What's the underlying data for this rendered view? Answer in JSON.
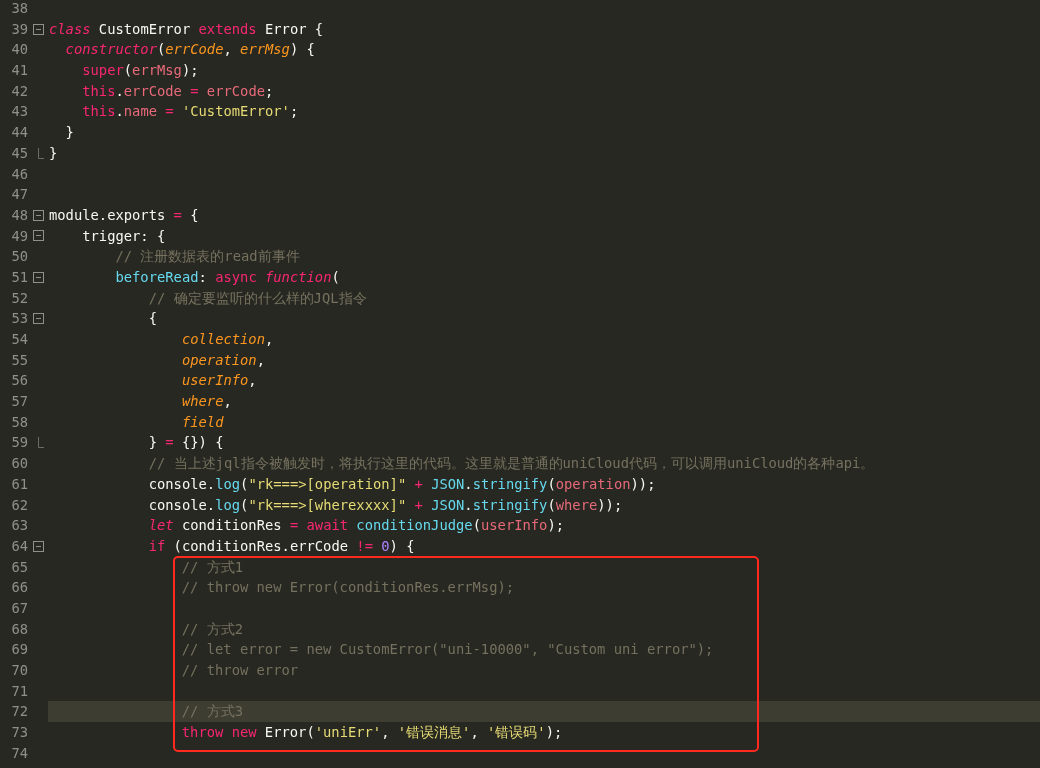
{
  "editor": {
    "lines": [
      {
        "number": "38"
      },
      {
        "number": "39",
        "collapsible": true,
        "tokens": [
          {
            "kind": "storage",
            "text": "class"
          },
          {
            "kind": "plain",
            "text": " CustomError "
          },
          {
            "kind": "keyword",
            "text": "extends"
          },
          {
            "kind": "plain",
            "text": " Error {"
          }
        ]
      },
      {
        "number": "40",
        "tokens": [
          {
            "kind": "storage",
            "text": "  constructor"
          },
          {
            "kind": "plain",
            "text": "("
          },
          {
            "kind": "param",
            "text": "errCode"
          },
          {
            "kind": "plain",
            "text": ", "
          },
          {
            "kind": "param",
            "text": "errMsg"
          },
          {
            "kind": "plain",
            "text": ") {"
          }
        ]
      },
      {
        "number": "41",
        "tokens": [
          {
            "kind": "keyword",
            "text": "    super"
          },
          {
            "kind": "plain",
            "text": "("
          },
          {
            "kind": "variable",
            "text": "errMsg"
          },
          {
            "kind": "plain",
            "text": ");"
          }
        ]
      },
      {
        "number": "42",
        "tokens": [
          {
            "kind": "keyword",
            "text": "    this"
          },
          {
            "kind": "plain",
            "text": "."
          },
          {
            "kind": "variable",
            "text": "errCode"
          },
          {
            "kind": "keyword",
            "text": " = "
          },
          {
            "kind": "variable",
            "text": "errCode"
          },
          {
            "kind": "plain",
            "text": ";"
          }
        ]
      },
      {
        "number": "43",
        "tokens": [
          {
            "kind": "keyword",
            "text": "    this"
          },
          {
            "kind": "plain",
            "text": "."
          },
          {
            "kind": "variable",
            "text": "name"
          },
          {
            "kind": "keyword",
            "text": " = "
          },
          {
            "kind": "string",
            "text": "'CustomError'"
          },
          {
            "kind": "plain",
            "text": ";"
          }
        ]
      },
      {
        "number": "44",
        "tokens": [
          {
            "kind": "plain",
            "text": "  }"
          }
        ]
      },
      {
        "number": "45",
        "fold_end": true,
        "tokens": [
          {
            "kind": "plain",
            "text": "}"
          }
        ]
      },
      {
        "number": "46"
      },
      {
        "number": "47"
      },
      {
        "number": "48",
        "collapsible": true,
        "tokens": [
          {
            "kind": "plain",
            "text": "module.exports"
          },
          {
            "kind": "keyword",
            "text": " = "
          },
          {
            "kind": "plain",
            "text": "{"
          }
        ]
      },
      {
        "number": "49",
        "collapsible": true,
        "tokens": [
          {
            "kind": "plain",
            "text": "    trigger: {"
          }
        ]
      },
      {
        "number": "50",
        "tokens": [
          {
            "kind": "comment",
            "text": "        // 注册数据表的read前事件"
          }
        ]
      },
      {
        "number": "51",
        "collapsible": true,
        "tokens": [
          {
            "kind": "support",
            "text": "        beforeRead"
          },
          {
            "kind": "plain",
            "text": ": "
          },
          {
            "kind": "keyword",
            "text": "async "
          },
          {
            "kind": "storage",
            "text": "function"
          },
          {
            "kind": "plain",
            "text": "("
          }
        ]
      },
      {
        "number": "52",
        "tokens": [
          {
            "kind": "comment",
            "text": "            // 确定要监听的什么样的JQL指令"
          }
        ]
      },
      {
        "number": "53",
        "collapsible": true,
        "tokens": [
          {
            "kind": "plain",
            "text": "            {"
          }
        ]
      },
      {
        "number": "54",
        "tokens": [
          {
            "kind": "param",
            "text": "                collection"
          },
          {
            "kind": "plain",
            "text": ","
          }
        ]
      },
      {
        "number": "55",
        "tokens": [
          {
            "kind": "param",
            "text": "                operation"
          },
          {
            "kind": "plain",
            "text": ","
          }
        ]
      },
      {
        "number": "56",
        "tokens": [
          {
            "kind": "param",
            "text": "                userInfo"
          },
          {
            "kind": "plain",
            "text": ","
          }
        ]
      },
      {
        "number": "57",
        "tokens": [
          {
            "kind": "param",
            "text": "                where"
          },
          {
            "kind": "plain",
            "text": ","
          }
        ]
      },
      {
        "number": "58",
        "tokens": [
          {
            "kind": "param",
            "text": "                field"
          }
        ]
      },
      {
        "number": "59",
        "fold_end": true,
        "tokens": [
          {
            "kind": "plain",
            "text": "            }"
          },
          {
            "kind": "keyword",
            "text": " = "
          },
          {
            "kind": "plain",
            "text": "{}) {"
          }
        ]
      },
      {
        "number": "60",
        "tokens": [
          {
            "kind": "comment",
            "text": "            // 当上述jql指令被触发时，将执行这里的代码。这里就是普通的uniCloud代码，可以调用uniCloud的各种api。"
          }
        ]
      },
      {
        "number": "61",
        "tokens": [
          {
            "kind": "plain",
            "text": "            console."
          },
          {
            "kind": "support",
            "text": "log"
          },
          {
            "kind": "plain",
            "text": "("
          },
          {
            "kind": "string",
            "text": "\"rk===>[operation]\""
          },
          {
            "kind": "keyword",
            "text": " + "
          },
          {
            "kind": "support",
            "text": "JSON"
          },
          {
            "kind": "plain",
            "text": "."
          },
          {
            "kind": "support",
            "text": "stringify"
          },
          {
            "kind": "plain",
            "text": "("
          },
          {
            "kind": "variable",
            "text": "operation"
          },
          {
            "kind": "plain",
            "text": "));"
          }
        ]
      },
      {
        "number": "62",
        "tokens": [
          {
            "kind": "plain",
            "text": "            console."
          },
          {
            "kind": "support",
            "text": "log"
          },
          {
            "kind": "plain",
            "text": "("
          },
          {
            "kind": "string",
            "text": "\"rk===>[wherexxxx]\""
          },
          {
            "kind": "keyword",
            "text": " + "
          },
          {
            "kind": "support",
            "text": "JSON"
          },
          {
            "kind": "plain",
            "text": "."
          },
          {
            "kind": "support",
            "text": "stringify"
          },
          {
            "kind": "plain",
            "text": "("
          },
          {
            "kind": "variable",
            "text": "where"
          },
          {
            "kind": "plain",
            "text": "));"
          }
        ]
      },
      {
        "number": "63",
        "tokens": [
          {
            "kind": "storage",
            "text": "            let"
          },
          {
            "kind": "plain",
            "text": " conditionRes"
          },
          {
            "kind": "keyword",
            "text": " = await"
          },
          {
            "kind": "support",
            "text": " conditionJudge"
          },
          {
            "kind": "plain",
            "text": "("
          },
          {
            "kind": "variable",
            "text": "userInfo"
          },
          {
            "kind": "plain",
            "text": ");"
          }
        ]
      },
      {
        "number": "64",
        "collapsible": true,
        "tokens": [
          {
            "kind": "keyword",
            "text": "            if"
          },
          {
            "kind": "plain",
            "text": " (conditionRes.errCode"
          },
          {
            "kind": "keyword",
            "text": " != "
          },
          {
            "kind": "number",
            "text": "0"
          },
          {
            "kind": "plain",
            "text": ") {"
          }
        ]
      }
    ],
    "boxed_lines": [
      {
        "number": "65",
        "tokens": [
          {
            "kind": "comment",
            "text": "// 方式1"
          }
        ]
      },
      {
        "number": "66",
        "tokens": [
          {
            "kind": "comment",
            "text": "// throw new Error(conditionRes.errMsg);"
          }
        ]
      },
      {
        "number": "67"
      },
      {
        "number": "68",
        "tokens": [
          {
            "kind": "comment",
            "text": "// 方式2"
          }
        ]
      },
      {
        "number": "69",
        "tokens": [
          {
            "kind": "comment",
            "text": "// let error = new CustomError(\"uni-10000\", \"Custom uni error\");"
          }
        ]
      },
      {
        "number": "70",
        "tokens": [
          {
            "kind": "comment",
            "text": "// throw error"
          }
        ]
      },
      {
        "number": "71"
      },
      {
        "number": "72",
        "selected": true,
        "tokens": [
          {
            "kind": "comment",
            "text": "// 方式3"
          }
        ]
      },
      {
        "number": "73",
        "tokens": [
          {
            "kind": "keyword",
            "text": "throw new"
          },
          {
            "kind": "plain",
            "text": " Error("
          },
          {
            "kind": "string",
            "text": "'uniErr'"
          },
          {
            "kind": "plain",
            "text": ", "
          },
          {
            "kind": "string",
            "text": "'错误消息'"
          },
          {
            "kind": "plain",
            "text": ", "
          },
          {
            "kind": "string",
            "text": "'错误码'"
          },
          {
            "kind": "plain",
            "text": ");"
          }
        ]
      }
    ],
    "lines_below": [
      {
        "number": "74"
      }
    ]
  }
}
